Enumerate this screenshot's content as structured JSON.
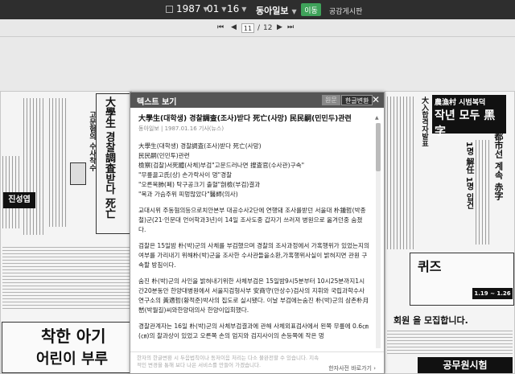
{
  "topbar": {
    "year": "1987",
    "month": "01",
    "day": "16",
    "newspaper": "동아일보",
    "move_button": "이동",
    "board_link": "공감게시판"
  },
  "pager": {
    "current": "11",
    "separator": "/",
    "total": "12"
  },
  "newspaper_snippets": {
    "headline_left": "大學生 경찰調査받다 死亡",
    "subhead_left": "고문혐의 수사착수",
    "ad_left": "진성엽",
    "ad_bottom": "착한 아기",
    "ad_bottom2": "어린이 부루",
    "headline_right": "작년 모두 黑字",
    "headline_right_top": "農漁村 시범복덕",
    "vertical_right": "1명 解任 1명 입건",
    "vertical_right2": "都市선 계속 赤字",
    "right_col": "大入합격자발표",
    "quiz": "퀴즈",
    "dates": "1.19 ~ 1.26",
    "recruit": "회원 을 모집합니다.",
    "bottom_right": "공무원시험"
  },
  "modal": {
    "title": "텍스트 보기",
    "tab_original": "원문",
    "tab_korean": "한글변환",
    "close": "✕",
    "article_title": "大學生(대학생) 경찰調査(조사)받다 死亡(사망) 民民嗣(민민두)관련",
    "article_meta": "동아일보 | 1987.01.16 기사(뉴스)",
    "sub_lines": [
      "大學生(대학생) 경찰調査(조사)받다 死亡(사망)",
      "民民嗣(민민투)관련",
      "檢察(검찰)서死體(사체)부검\"고문드러나면 搜査官(수사관)구속\"",
      "\"무릎꿇고氏(상) 손가락사이 멍\"경찰",
      "\"오른목肺(폐) 탁구공크기 출혈\"剖檢(부검)결과",
      "\"목과 가슴주위 피멍많았다\"醫師(의사)"
    ],
    "paragraphs": [
      "교대시위 주동혐의등으로치안본부 대공수사2단에 연행돼 조사를받던 서울대 朴鍾哲(박종철)군(21·인문대 언어학과3년)이 14일 조사도중 갑자기 쓰러져 병원으로 옮겨던중 숨졌다.",
      "검찰은 15일밤 朴(박)군의 사체를 부검했으며 경찰의 조사과정에서 가혹행위가 있었는지의 여부를 가리내기 위해朴(박)군을 조사한 수사관들을소환,가혹행위사실이 밝혀지면 관원 구속할 방침이다.",
      "숨진 朴(박)군의 사인을 밝혀내기위한 사체부검은 15일밤9시5분부터 10시25분까지1시간20분동안 한양대병원에서 서울지검형사부 安商守(안상수)검사의 지휘와 국립과학수사연구소의 黃適哲(황적준)박사의 집도로 실시됐다. 이날 부검에는숨진 朴(박)군의 삼촌朴月嵆(박월길)씨와한양대의사 한양이입회했다.",
      "경찰관계자는 16일 朴(박)군의 사체부검결과에 관해 사체외표검사에서 왼쪽 무릎에 0.6㎝(㎝)의 찰과상이 있었고 오른쪽 손의 엄지와 검지사이의 손등쪽에 작은 멍"
    ],
    "footer_text": "한자의 한글변환 시 두음법칙이나 동저이음 처리는 다소 불완전할 수 있습니다. 지속적인 변경을 통해 보다 나은 서비스를 만들어 가겠습니다.",
    "footer_link": "한자사전 바로가기 ›"
  }
}
